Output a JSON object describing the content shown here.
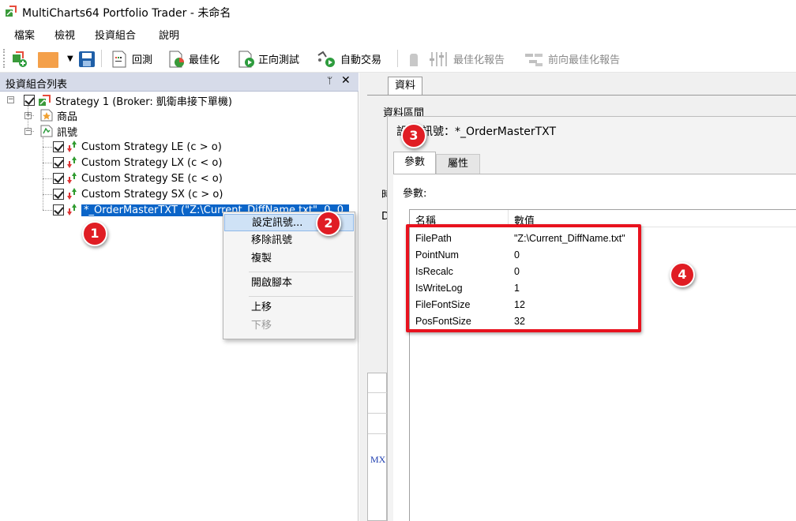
{
  "window": {
    "title": "MultiCharts64 Portfolio Trader - 未命名",
    "icon": "multicharts-app-icon"
  },
  "menubar": {
    "items": [
      "檔案",
      "檢視",
      "投資組合",
      "說明"
    ]
  },
  "toolbar": {
    "backtest": "回測",
    "optimize": "最佳化",
    "forward_test": "正向測試",
    "auto_trade": "自動交易",
    "optimize_report": "最佳化報告",
    "forward_optimize_report": "前向最佳化報告"
  },
  "left_panel": {
    "title": "投資組合列表",
    "pin_glyph": "ᛘ",
    "close_glyph": "✕",
    "strategy_root": "Strategy 1 (Broker: 凱衛串接下單機)",
    "products": "商品",
    "signals_node": "訊號",
    "signals": [
      "Custom Strategy LE (c > o)",
      "Custom Strategy LX (c < o)",
      "Custom Strategy SE (c < o)",
      "Custom Strategy SX (c > o)"
    ],
    "selected_signal": "*_OrderMasterTXT (\"Z:\\Current_DiffName.txt\", 0, 0,"
  },
  "context_menu": {
    "items": [
      {
        "label": "設定訊號...",
        "highlighted": true,
        "enabled": true
      },
      {
        "label": "移除訊號",
        "enabled": true
      },
      {
        "label": "複製",
        "enabled": true
      },
      {
        "label": "開啟腳本",
        "enabled": true
      },
      {
        "label": "上移",
        "enabled": true
      },
      {
        "label": "下移",
        "enabled": false
      }
    ]
  },
  "main_area": {
    "tab": "資料",
    "section_label": "資料區間",
    "partial_label_1": "時",
    "partial_label_2": "D",
    "partial_text": "MX"
  },
  "dialog": {
    "title": "訊號：*_OrderMasterTXT",
    "title_visible_prefix": "設",
    "title_visible_suffix": "訊號：*_OrderMasterTXT",
    "tabs": [
      "參數",
      "屬性"
    ],
    "active_tab": "參數",
    "params_label": "參數:",
    "columns": [
      "名稱",
      "數值"
    ],
    "params": [
      {
        "name": "FilePath",
        "value": "\"Z:\\Current_DiffName.txt\""
      },
      {
        "name": "PointNum",
        "value": "0"
      },
      {
        "name": "IsRecalc",
        "value": "0"
      },
      {
        "name": "IsWriteLog",
        "value": "1"
      },
      {
        "name": "FileFontSize",
        "value": "12"
      },
      {
        "name": "PosFontSize",
        "value": "32"
      }
    ]
  },
  "annotations": {
    "badges": [
      "1",
      "2",
      "3",
      "4"
    ],
    "badge_color": "#e01d24",
    "highlight_color": "#e8121e"
  },
  "colors": {
    "selection": "#0a64c8",
    "panel_header": "#d6dbe9",
    "menu_highlight": "#cfe2f6"
  }
}
